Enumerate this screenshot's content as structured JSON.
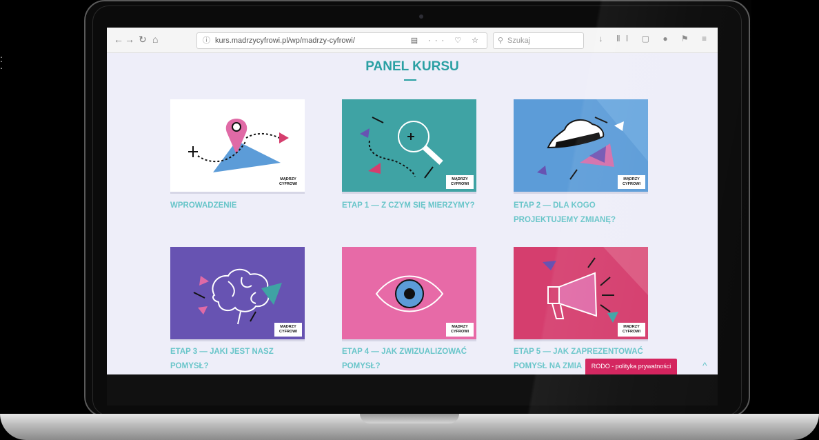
{
  "browser": {
    "back": "←",
    "forward": "→",
    "reload": "↻",
    "home": "⌂",
    "url": "kurs.madrzycyfrowi.pl/wp/madrzy-cyfrowi/",
    "search_placeholder": "Szukaj",
    "info_icon": "ⓘ",
    "search_icon": "⚲",
    "url_tools": "▤ ··· ♡ ☆",
    "right_tools": "↓ ⅡⅠ ▢ ● ⚑ ≡"
  },
  "page": {
    "title": "PANEL KURSU",
    "cards": [
      {
        "title": "WPROWADZENIE",
        "bg": "#ffffff"
      },
      {
        "title": "ETAP 1 — Z CZYM SIĘ MIERZYMY?",
        "bg": "#3fa3a4"
      },
      {
        "title": "ETAP 2 — DLA KOGO PROJEKTUJEMY ZMIANĘ?",
        "bg": "#5c9cd8"
      },
      {
        "title": "ETAP 3 — JAKI JEST NASZ POMYSŁ?",
        "bg": "#6753b2"
      },
      {
        "title": "ETAP 4 — JAK ZWIZUALIZOWAĆ POMYSŁ?",
        "bg": "#e76aa7"
      },
      {
        "title": "ETAP 5 — JAK ZAPREZENTOWAĆ POMYSŁ NA ZMIA",
        "bg": "#d53e6e"
      }
    ],
    "logo_line1": "MĄDRZY",
    "logo_line2": "CYFROWI"
  },
  "rodo_label": "RODO - polityka prywatności",
  "scroll_up": "^",
  "colors": {
    "accent": "#2aa0a3",
    "card_title": "#68c5c9",
    "rodo": "#d3215c",
    "page_bg": "#eeeef9"
  }
}
